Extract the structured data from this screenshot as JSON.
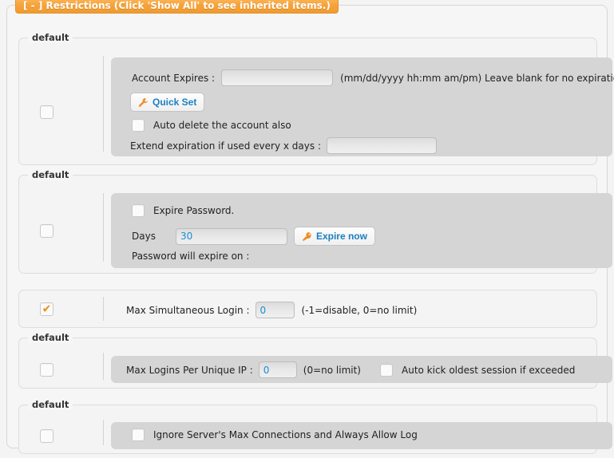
{
  "panel": {
    "legend": "[ - ] Restrictions (Click 'Show All' to see inherited items.)",
    "legend_bg": "#f5a332",
    "legend_text_color": "#ffffff",
    "accent_orange": "#f08a1a",
    "link_blue": "#1a7fc1",
    "value_blue": "#1a8fd4"
  },
  "sections": [
    {
      "legend": "default",
      "enable_checkbox": {
        "name": "account-expires-enable",
        "checked": false
      },
      "fields": {
        "account_expires_label": "Account Expires :",
        "account_expires_value": "",
        "account_expires_hint": "(mm/dd/yyyy hh:mm am/pm) Leave blank for no expiration.",
        "quick_set_label": "Quick Set",
        "quick_set_icon": "wrench-icon",
        "auto_delete_label": "Auto delete the account also",
        "auto_delete_checked": false,
        "extend_label": "Extend expiration if used every x days :",
        "extend_value": ""
      }
    },
    {
      "legend": "default",
      "enable_checkbox": {
        "name": "expire-password-enable",
        "checked": false
      },
      "fields": {
        "expire_password_label": "Expire Password.",
        "expire_password_checked": false,
        "days_label": "Days",
        "days_value": "30",
        "expire_now_label": "Expire now",
        "expire_now_icon": "key-icon",
        "will_expire_label": "Password will expire on :"
      }
    },
    {
      "legend": "",
      "enable_checkbox": {
        "name": "max-simultaneous-login-enable",
        "checked": true
      },
      "fields": {
        "max_login_label": "Max Simultaneous Login :",
        "max_login_value": "0",
        "max_login_hint": "(-1=disable, 0=no limit)"
      }
    },
    {
      "legend": "default",
      "enable_checkbox": {
        "name": "max-logins-per-ip-enable",
        "checked": false
      },
      "fields": {
        "max_ip_label": "Max Logins Per Unique IP :",
        "max_ip_value": "0",
        "max_ip_hint": "(0=no limit)",
        "auto_kick_label": "Auto kick oldest session if exceeded",
        "auto_kick_checked": false
      }
    },
    {
      "legend": "default",
      "enable_checkbox": {
        "name": "ignore-max-connections-enable",
        "checked": false
      },
      "fields": {
        "ignore_label": "Ignore Server's Max Connections and Always Allow Log",
        "ignore_checked": false
      }
    }
  ]
}
